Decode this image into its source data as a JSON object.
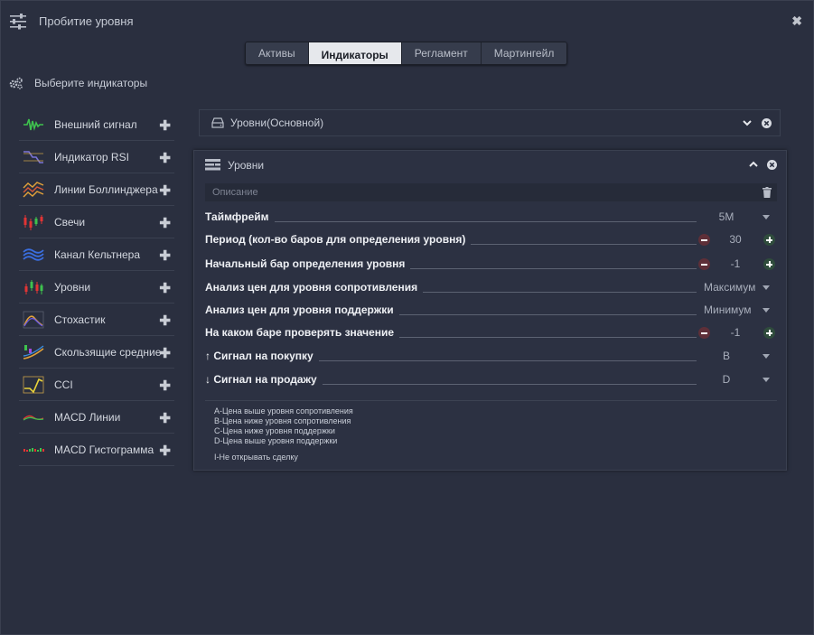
{
  "window": {
    "title": "Пробитие уровня"
  },
  "tabs": [
    {
      "label": "Активы",
      "active": false
    },
    {
      "label": "Индикаторы",
      "active": true
    },
    {
      "label": "Регламент",
      "active": false
    },
    {
      "label": "Мартингейл",
      "active": false
    }
  ],
  "section": {
    "heading": "Выберите индикаторы"
  },
  "indicators": [
    {
      "name": "Внешний сигнал",
      "icon": "external-signal-icon"
    },
    {
      "name": "Индикатор RSI",
      "icon": "rsi-icon"
    },
    {
      "name": "Линии Боллинджера",
      "icon": "bollinger-icon"
    },
    {
      "name": "Свечи",
      "icon": "candles-icon"
    },
    {
      "name": "Канал Кельтнера",
      "icon": "keltner-icon"
    },
    {
      "name": "Уровни",
      "icon": "levels-icon"
    },
    {
      "name": "Стохастик",
      "icon": "stochastic-icon"
    },
    {
      "name": "Скользящие средние",
      "icon": "moving-average-icon"
    },
    {
      "name": "CCI",
      "icon": "cci-icon"
    },
    {
      "name": "MACD Линии",
      "icon": "macd-lines-icon"
    },
    {
      "name": "MACD Гистограмма",
      "icon": "macd-histogram-icon"
    }
  ],
  "selected": {
    "label": "Уровни(Основной)"
  },
  "panel": {
    "title": "Уровни",
    "description_placeholder": "Описание",
    "rows": [
      {
        "label": "Таймфрейм",
        "value": "5M"
      },
      {
        "label": "Период (кол-во баров для определения уровня)",
        "value": "30"
      },
      {
        "label": "Начальный бар определения уровня",
        "value": "-1"
      },
      {
        "label": "Анализ цен для уровня сопротивления",
        "value": "Максимум"
      },
      {
        "label": "Анализ цен для уровня поддержки",
        "value": "Минимум"
      },
      {
        "label": "На каком баре проверять значение",
        "value": "-1"
      },
      {
        "label": "↑ Сигнал на покупку",
        "value": "B"
      },
      {
        "label": "↓ Сигнал на продажу",
        "value": "D"
      }
    ],
    "legend": [
      "A-Цена выше уровня сопротивления",
      "B-Цена ниже уровня сопротивления",
      "C-Цена ниже уровня поддержки",
      "D-Цена выше уровня поддержки",
      "I-Не открывать сделку"
    ]
  },
  "colors": {
    "background": "#2a2f3f",
    "minus": "#5e2f38",
    "plus": "#2f4c3c",
    "active_tab": "#e6e8ec"
  }
}
